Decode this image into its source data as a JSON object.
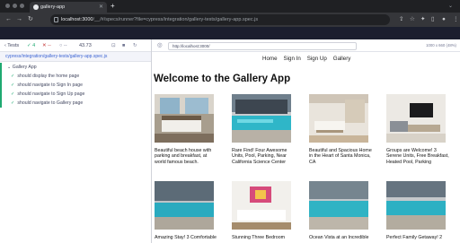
{
  "browser": {
    "tab_title": "gallery-app",
    "url_host": "localhost:3000",
    "url_path": "/__/#/specs/runner?file=cypress/integration/gallery-tests/gallery-app.spec.js"
  },
  "runner": {
    "tests_label": "Tests",
    "passed": "4",
    "failed": "--",
    "pending": "--",
    "duration": "43.73",
    "spec_file": "cypress/integration/gallery-tests/gallery-app.spec.js",
    "suite_title": "Gallery App",
    "tests": [
      {
        "label": "should display the home page"
      },
      {
        "label": "should navigate to Sign In page"
      },
      {
        "label": "should navigate to Sign Up page"
      },
      {
        "label": "should navigate to Gallery page"
      }
    ]
  },
  "aut": {
    "url": "http://localhost:3000/",
    "viewport": "1000 x 660",
    "zoom": "(48%)"
  },
  "app": {
    "nav": [
      "Home",
      "Sign In",
      "Sign Up",
      "Gallery"
    ],
    "heading": "Welcome to the Gallery App",
    "cards": [
      {
        "title": "Beautiful beach house with parking and breakfast, at world famous beach.",
        "image": "bedroom"
      },
      {
        "title": "Rare Find! Four Awesome Units, Pool, Parking, Near California Science Center",
        "image": "pool"
      },
      {
        "title": "Beautiful and Spacious Home in the Heart of Santa Monica, CA",
        "image": "living-room"
      },
      {
        "title": "Groups are Welcome! 3 Serene Units, Free Breakfast, Heated Pool, Parking",
        "image": "tv-room"
      },
      {
        "title": "Amazing Stay! 3 Comfortable",
        "image": "pool"
      },
      {
        "title": "Stunning Three Bedroom",
        "image": "bedroom-art"
      },
      {
        "title": "Ocean Vista at an Incredible",
        "image": "pool"
      },
      {
        "title": "Perfect Family Getaway! 2",
        "image": "pool"
      }
    ]
  }
}
